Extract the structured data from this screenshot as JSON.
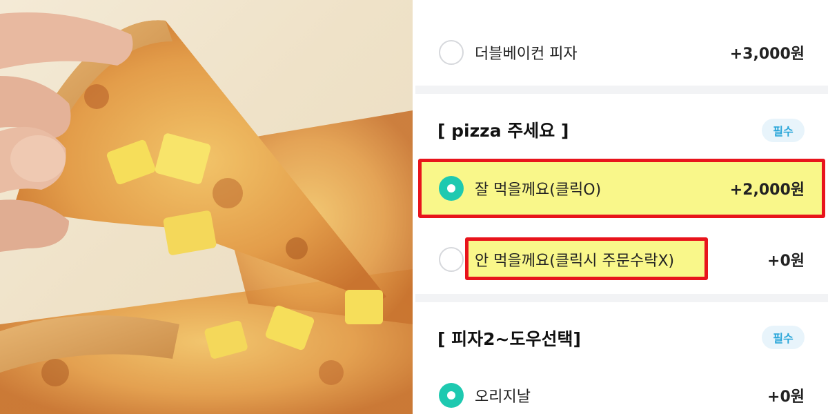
{
  "menu": {
    "option_double_bacon": {
      "label": "더블베이컨 피자",
      "price": "+3,000원"
    },
    "section_pizza": {
      "title": "[ pizza 주세요 ]",
      "badge": "필수"
    },
    "option_eat": {
      "label": "잘 먹을께요(클릭O)",
      "price": "+2,000원",
      "selected": true
    },
    "option_not_eat": {
      "label": "안 먹을께요(클릭시 주문수락X)",
      "price": "+0원",
      "selected": false
    },
    "section_dough": {
      "title": "[ 피자2~도우선택]",
      "badge": "필수"
    },
    "option_original": {
      "label": "오리지날",
      "price": "+0원",
      "selected": true
    }
  },
  "colors": {
    "accent": "#1ec9b0",
    "highlight_border": "#e8141c",
    "highlight_fill": "#f9f78a",
    "badge_text": "#2aa6d9"
  }
}
